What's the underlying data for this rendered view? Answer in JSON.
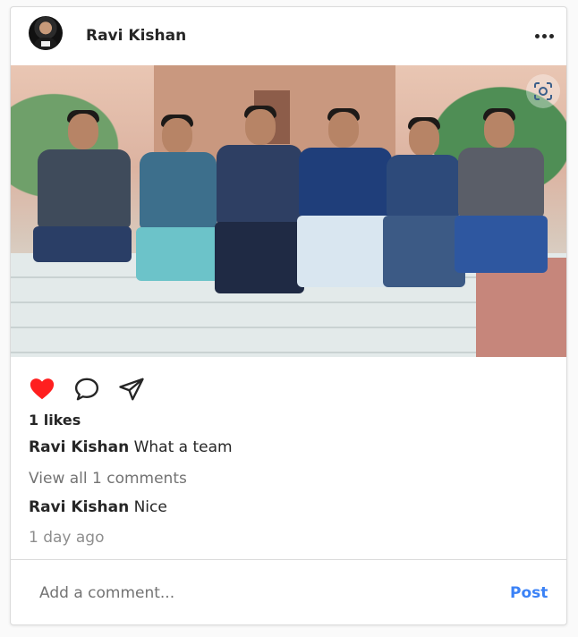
{
  "post": {
    "username": "Ravi Kishan",
    "likes_text": "1 likes",
    "caption": {
      "author": "Ravi Kishan",
      "text": "What a team"
    },
    "view_comments_label": "View all 1 comments",
    "comments": [
      {
        "author": "Ravi Kishan",
        "text": "Nice"
      }
    ],
    "timestamp": "1 day ago",
    "liked": true
  },
  "comment_box": {
    "placeholder": "Add a comment...",
    "post_label": "Post"
  },
  "icons": {
    "more": "more-horizontal-icon",
    "scan": "scan-icon",
    "like": "heart-icon",
    "comment": "comment-icon",
    "share": "send-icon"
  },
  "colors": {
    "like_active": "#ff1f1f",
    "post_button": "#3b82f6",
    "muted_text": "#737373"
  }
}
